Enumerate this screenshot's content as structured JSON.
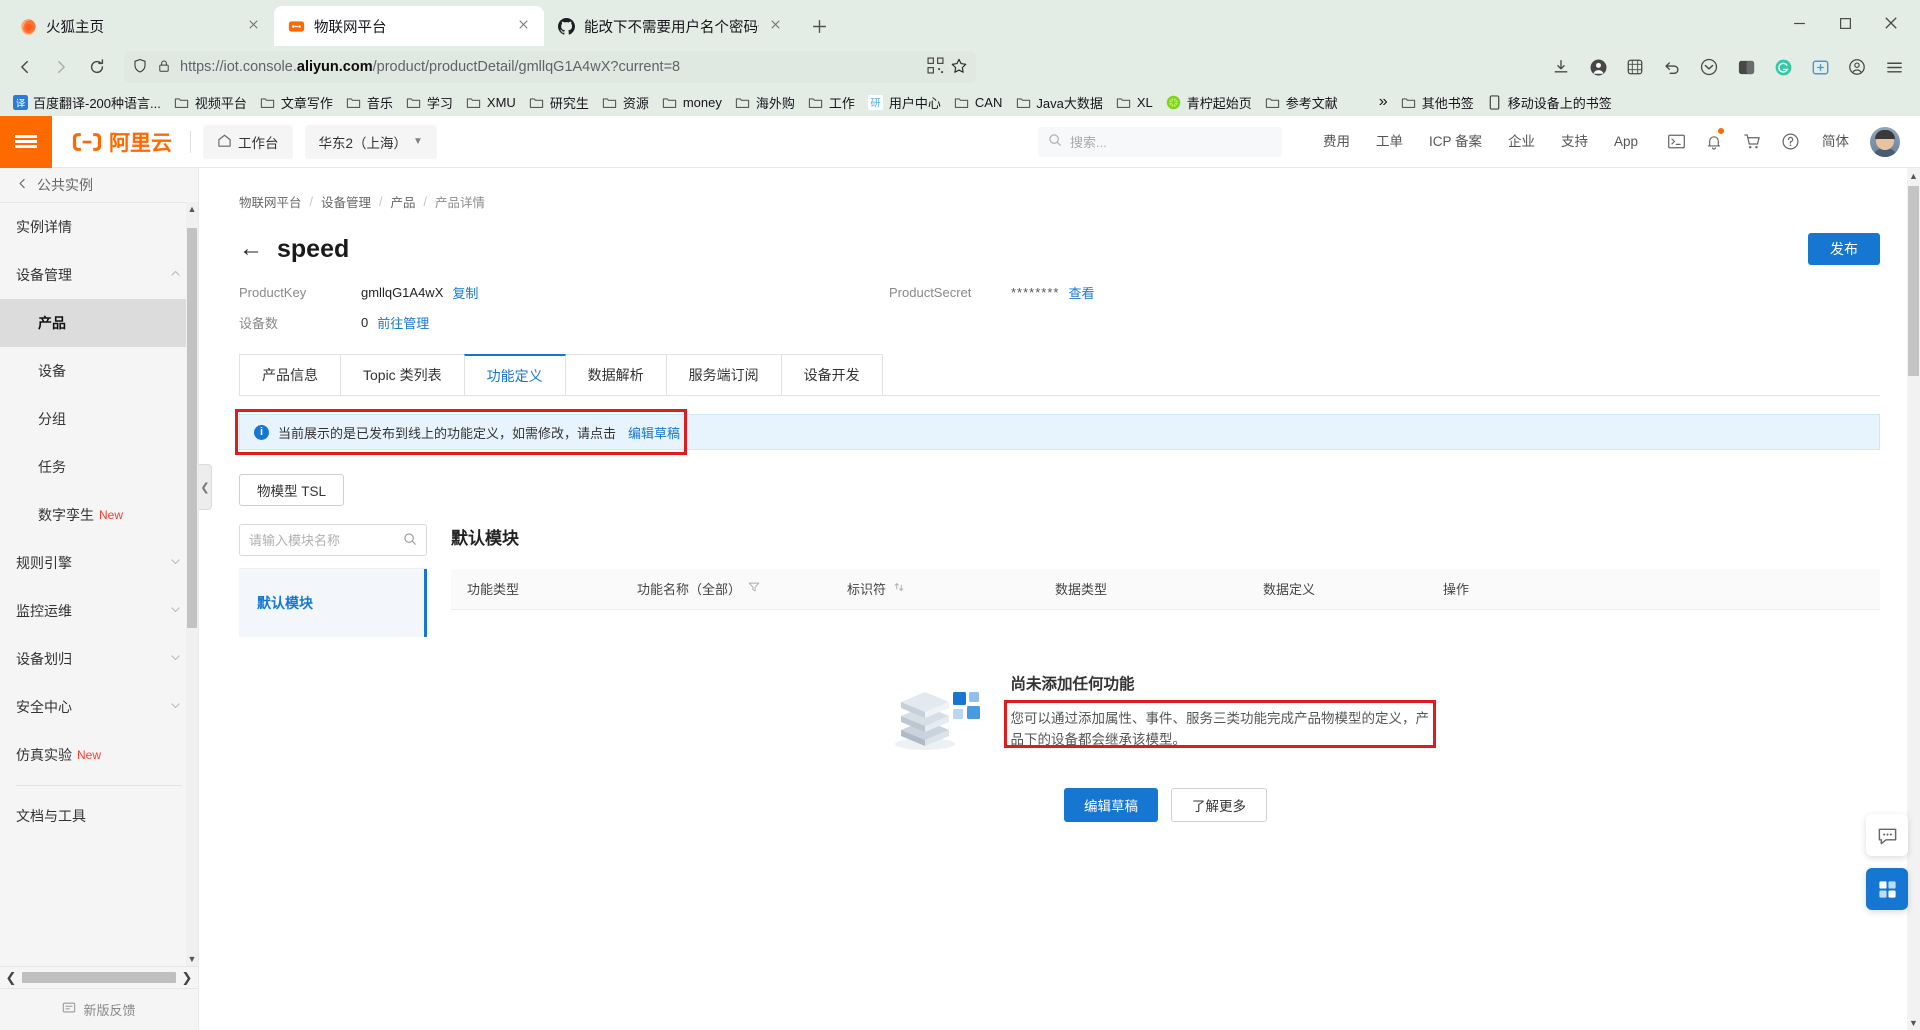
{
  "browser": {
    "tabs": [
      {
        "title": "火狐主页",
        "favicon": "firefox-icon"
      },
      {
        "title": "物联网平台",
        "favicon": "aliyun-iot-icon"
      },
      {
        "title": "能改下不需要用户名个密码也可",
        "favicon": "github-icon"
      }
    ],
    "new_tab_label": "+",
    "window_controls": {
      "minimize": "–",
      "maximize": "□",
      "close": "✕"
    },
    "url": {
      "prefix": "https://iot.console.",
      "domain": "aliyun.com",
      "path": "/product/productDetail/gmllqG1A4wX?current=8",
      "full": "https://iot.console.aliyun.com/product/productDetail/gmllqG1A4wX?current=8"
    },
    "bookmarks": [
      {
        "label": "百度翻译-200种语言...",
        "icon": "translate-icon"
      },
      {
        "label": "视频平台",
        "icon": "folder-icon"
      },
      {
        "label": "文章写作",
        "icon": "folder-icon"
      },
      {
        "label": "音乐",
        "icon": "folder-icon"
      },
      {
        "label": "学习",
        "icon": "folder-icon"
      },
      {
        "label": "XMU",
        "icon": "folder-icon"
      },
      {
        "label": "研究生",
        "icon": "folder-icon"
      },
      {
        "label": "资源",
        "icon": "folder-icon"
      },
      {
        "label": "money",
        "icon": "folder-icon"
      },
      {
        "label": "海外购",
        "icon": "folder-icon"
      },
      {
        "label": "工作",
        "icon": "folder-icon"
      },
      {
        "label": "用户中心",
        "icon": "research-icon"
      },
      {
        "label": "CAN",
        "icon": "folder-icon"
      },
      {
        "label": "Java大数据",
        "icon": "folder-icon"
      },
      {
        "label": "XL",
        "icon": "folder-icon"
      },
      {
        "label": "青柠起始页",
        "icon": "lime-icon"
      },
      {
        "label": "参考文献",
        "icon": "folder-icon"
      }
    ],
    "bookmarks_overflow": "»",
    "bookmarks_tail": [
      {
        "label": "其他书签",
        "icon": "folder-icon"
      },
      {
        "label": "移动设备上的书签",
        "icon": "mobile-icon"
      }
    ]
  },
  "console_header": {
    "menu_icon": "hamburger-icon",
    "logo_text": "阿里云",
    "workbench": "工作台",
    "region": "华东2（上海）",
    "search_placeholder": "搜索...",
    "nav": [
      "费用",
      "工单",
      "ICP 备案",
      "企业",
      "支持",
      "App"
    ],
    "icons": [
      "terminal-icon",
      "bell-icon",
      "cart-icon",
      "help-icon"
    ],
    "language": "简体"
  },
  "sidebar": {
    "instance_header": "公共实例",
    "items": [
      {
        "label": "实例详情",
        "type": "link"
      },
      {
        "label": "设备管理",
        "type": "group",
        "expanded": true
      },
      {
        "label": "产品",
        "type": "child",
        "active": true
      },
      {
        "label": "设备",
        "type": "child"
      },
      {
        "label": "分组",
        "type": "child"
      },
      {
        "label": "任务",
        "type": "child"
      },
      {
        "label": "数字孪生",
        "type": "child",
        "tag": "New"
      },
      {
        "label": "规则引擎",
        "type": "group"
      },
      {
        "label": "监控运维",
        "type": "group"
      },
      {
        "label": "设备划归",
        "type": "group"
      },
      {
        "label": "安全中心",
        "type": "group"
      },
      {
        "label": "仿真实验",
        "type": "link",
        "tag": "New"
      },
      {
        "label": "文档与工具",
        "type": "link"
      }
    ],
    "footer": "新版反馈"
  },
  "page": {
    "breadcrumb": [
      "物联网平台",
      "设备管理",
      "产品",
      "产品详情"
    ],
    "breadcrumb_sep": "/",
    "back_arrow": "←",
    "title": "speed",
    "publish_button": "发布",
    "meta": {
      "product_key_label": "ProductKey",
      "product_key_value": "gmllqG1A4wX",
      "copy_link": "复制",
      "device_count_label": "设备数",
      "device_count_value": "0",
      "manage_link": "前往管理",
      "product_secret_label": "ProductSecret",
      "product_secret_value": "********",
      "view_link": "查看"
    },
    "tabs": [
      {
        "label": "产品信息",
        "active": false
      },
      {
        "label": "Topic 类列表",
        "active": false
      },
      {
        "label": "功能定义",
        "active": true
      },
      {
        "label": "数据解析",
        "active": false
      },
      {
        "label": "服务端订阅",
        "active": false
      },
      {
        "label": "设备开发",
        "active": false
      }
    ],
    "notice": {
      "text": "当前展示的是已发布到线上的功能定义，如需修改，请点击",
      "link": "编辑草稿",
      "icon": "info-icon"
    },
    "tsl_button": "物模型 TSL",
    "module_search_placeholder": "请输入模块名称",
    "module_search_icon": "search-icon",
    "modules": [
      {
        "label": "默认模块",
        "active": true
      }
    ],
    "detail_title": "默认模块",
    "table_headers": [
      {
        "label": "功能类型"
      },
      {
        "label": "功能名称（全部）",
        "icon": "filter-icon"
      },
      {
        "label": "标识符",
        "icon": "sort-icon"
      },
      {
        "label": "数据类型"
      },
      {
        "label": "数据定义"
      },
      {
        "label": "操作"
      }
    ],
    "empty_state": {
      "heading": "尚未添加任何功能",
      "description": "您可以通过添加属性、事件、服务三类功能完成产品物模型的定义，产品下的设备都会继承该模型。",
      "primary_button": "编辑草稿",
      "secondary_button": "了解更多"
    },
    "float_buttons": [
      {
        "icon": "chat-icon"
      },
      {
        "icon": "apps-icon"
      }
    ]
  },
  "colors": {
    "accent": "#1677d2",
    "brand_orange": "#ff6a00",
    "highlight_red": "#e01b1b",
    "new_tag": "#ff3b30"
  }
}
